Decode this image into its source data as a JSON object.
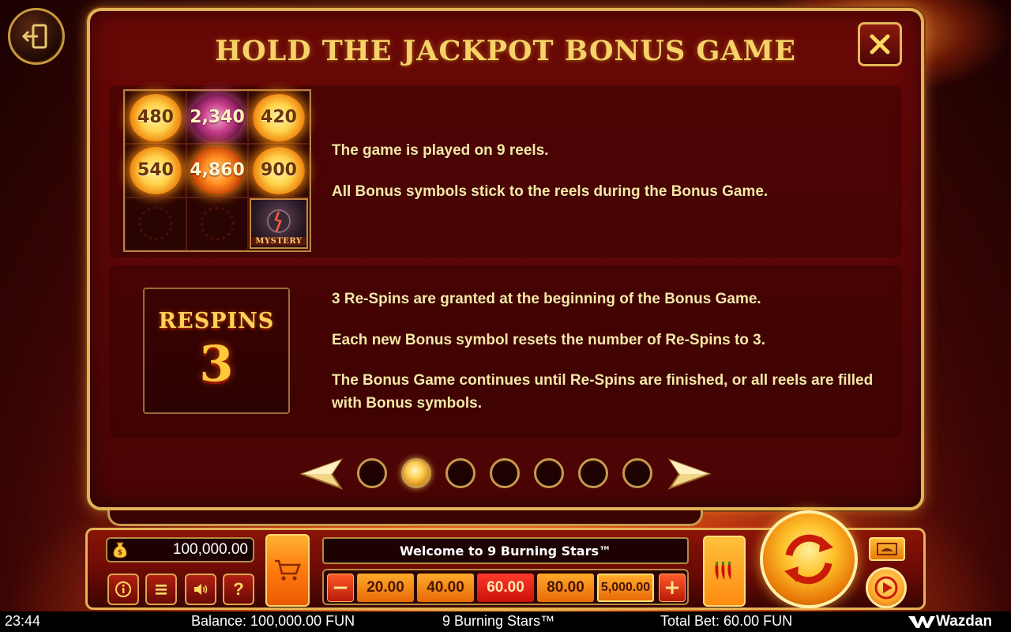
{
  "panel": {
    "title": "HOLD THE JACKPOT BONUS GAME",
    "close_icon": "close-icon"
  },
  "reels": {
    "coins": [
      "480",
      "2,340",
      "420",
      "540",
      "4,860",
      "900"
    ],
    "mystery_label": "MYSTERY"
  },
  "rules": {
    "line1": "The game is played on 9 reels.",
    "line2": "All Bonus symbols stick to the reels during the Bonus Game.",
    "line3": "3 Re-Spins are granted at the beginning of the Bonus Game.",
    "line4": "Each new Bonus symbol resets the number of Re-Spins to 3.",
    "line5": "The Bonus Game continues until Re-Spins are finished, or all reels are filled with Bonus symbols."
  },
  "respins": {
    "label": "RESPINS",
    "count": "3"
  },
  "pager": {
    "total_pages": 7,
    "active_page": 2
  },
  "console": {
    "balance": "100,000.00",
    "welcome": "Welcome to 9 Burning Stars™",
    "bet_minus": "−",
    "bet_plus": "+",
    "bet_options": [
      "20.00",
      "40.00",
      "60.00",
      "80.00",
      "5,000.00"
    ],
    "selected_bet": "60.00",
    "help_label": "?"
  },
  "status": {
    "time": "23:44",
    "balance": "Balance: 100,000.00 FUN",
    "game_name": "9 Burning Stars™",
    "total_bet": "Total Bet: 60.00 FUN",
    "brand": "Wazdan"
  },
  "colors": {
    "gold": "#f8d268",
    "panel_red": "#560605",
    "text": "#f8e7a6"
  }
}
